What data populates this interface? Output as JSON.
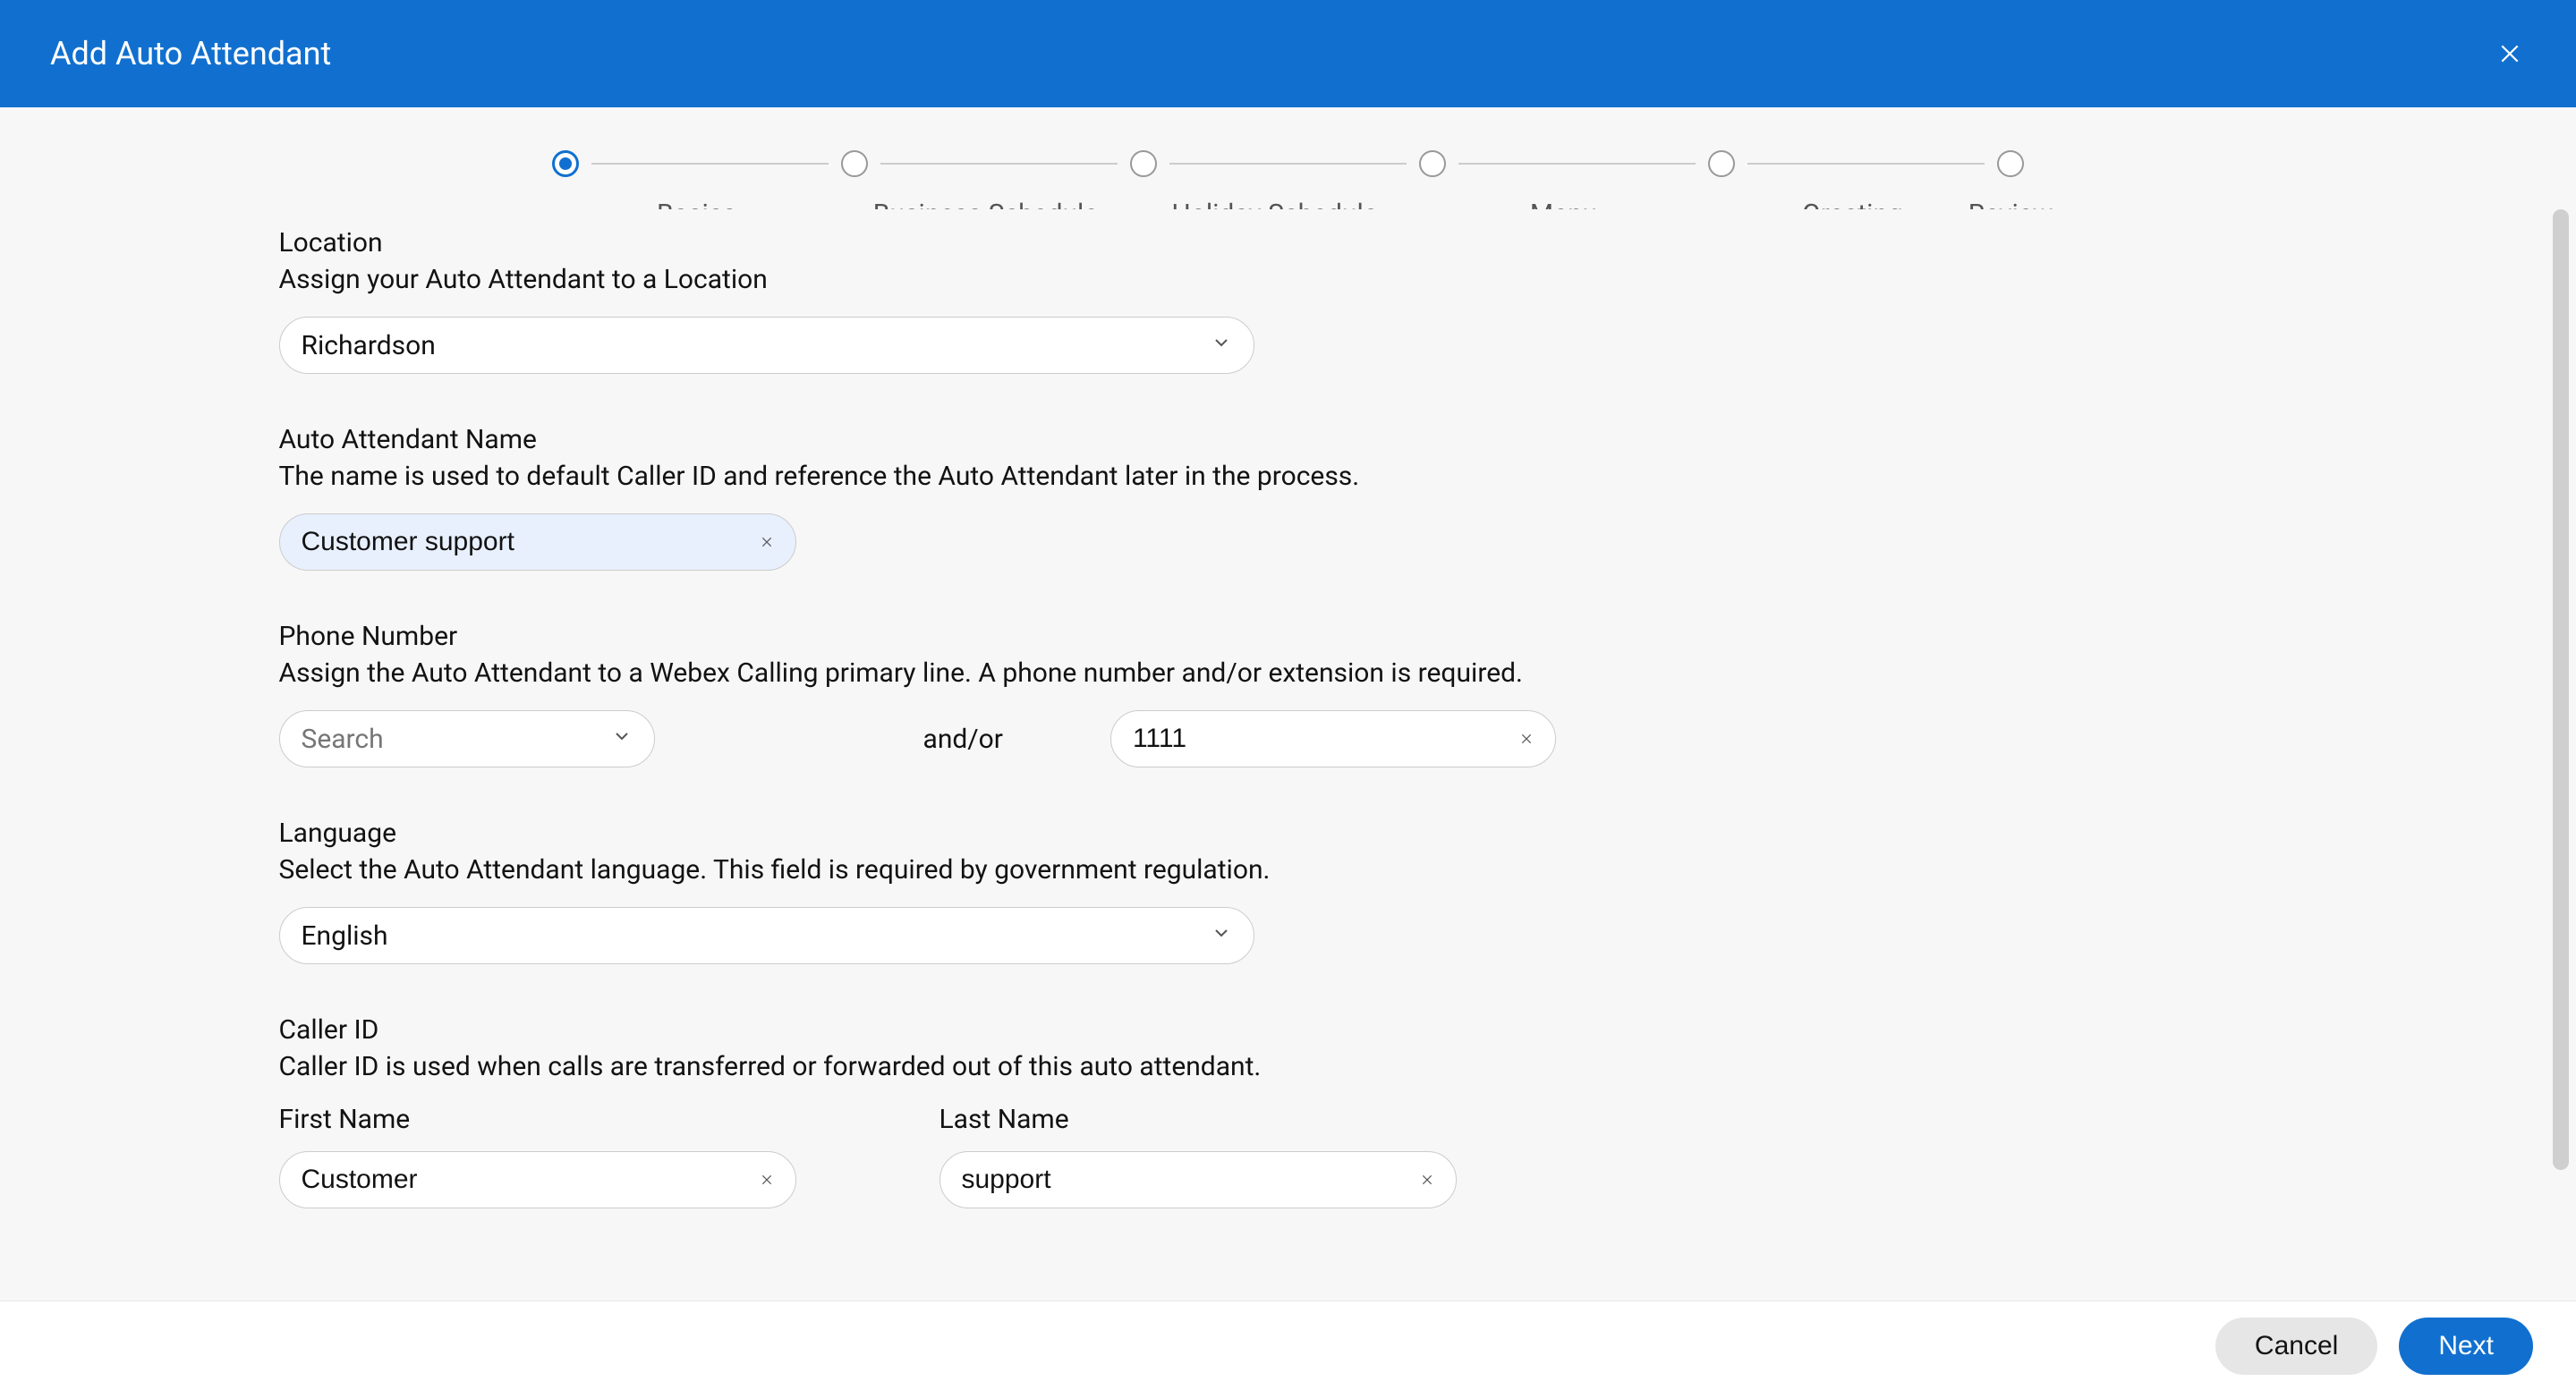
{
  "header": {
    "title": "Add Auto Attendant"
  },
  "stepper": {
    "steps": [
      {
        "label": "Basics",
        "active": true
      },
      {
        "label": "Business Schedule",
        "active": false
      },
      {
        "label": "Holiday Schedule",
        "active": false
      },
      {
        "label": "Menu",
        "active": false
      },
      {
        "label": "Greeting",
        "active": false
      },
      {
        "label": "Review",
        "active": false
      }
    ]
  },
  "form": {
    "location": {
      "label": "Location",
      "desc": "Assign your Auto Attendant to a Location",
      "value": "Richardson"
    },
    "name": {
      "label": "Auto Attendant Name",
      "desc": "The name is used to default Caller ID and reference the Auto Attendant later in the process.",
      "value": "Customer support"
    },
    "phone": {
      "label": "Phone Number",
      "desc": "Assign the Auto Attendant to a Webex Calling primary line. A phone number and/or extension is required.",
      "search_placeholder": "Search",
      "and_or": "and/or",
      "extension_value": "1111"
    },
    "language": {
      "label": "Language",
      "desc": "Select the Auto Attendant language. This field is required by government regulation.",
      "value": "English"
    },
    "caller_id": {
      "label": "Caller ID",
      "desc": "Caller ID is used when calls are transferred or forwarded out of this auto attendant.",
      "first_name_label": "First Name",
      "first_name_value": "Customer",
      "last_name_label": "Last Name",
      "last_name_value": "support"
    }
  },
  "footer": {
    "cancel": "Cancel",
    "next": "Next"
  }
}
